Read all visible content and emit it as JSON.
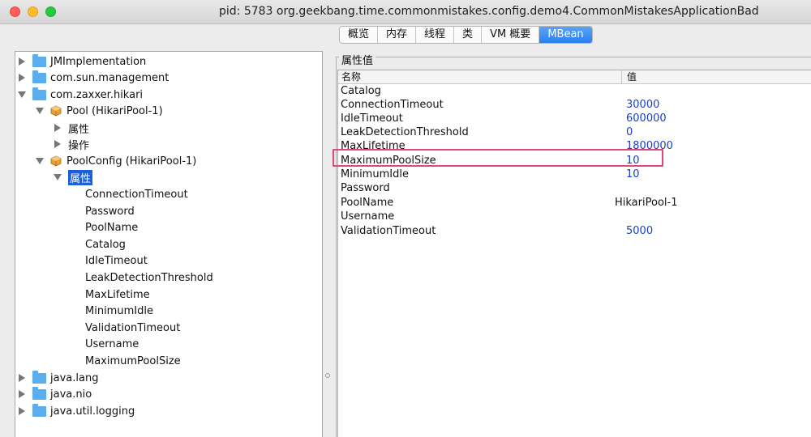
{
  "window": {
    "title": "pid: 5783 org.geekbang.time.commonmistakes.config.demo4.CommonMistakesApplicationBad"
  },
  "tabs": [
    {
      "label": "概览"
    },
    {
      "label": "内存"
    },
    {
      "label": "线程"
    },
    {
      "label": "类"
    },
    {
      "label": "VM 概要"
    },
    {
      "label": "MBean",
      "active": true
    }
  ],
  "tree": {
    "nodes": [
      {
        "label": "JMImplementation"
      },
      {
        "label": "com.sun.management"
      },
      {
        "label": "com.zaxxer.hikari"
      },
      {
        "label": "Pool (HikariPool-1)"
      },
      {
        "label": "属性"
      },
      {
        "label": "操作"
      },
      {
        "label": "PoolConfig (HikariPool-1)"
      },
      {
        "label": "属性",
        "selected": true
      },
      {
        "label": "ConnectionTimeout"
      },
      {
        "label": "Password"
      },
      {
        "label": "PoolName"
      },
      {
        "label": "Catalog"
      },
      {
        "label": "IdleTimeout"
      },
      {
        "label": "LeakDetectionThreshold"
      },
      {
        "label": "MaxLifetime"
      },
      {
        "label": "MinimumIdle"
      },
      {
        "label": "ValidationTimeout"
      },
      {
        "label": "Username"
      },
      {
        "label": "MaximumPoolSize"
      },
      {
        "label": "java.lang"
      },
      {
        "label": "java.nio"
      },
      {
        "label": "java.util.logging"
      }
    ]
  },
  "attributes": {
    "group_title": "属性值",
    "columns": {
      "name": "名称",
      "value": "值"
    },
    "rows": [
      {
        "name": "Catalog",
        "value": ""
      },
      {
        "name": "ConnectionTimeout",
        "value": "30000"
      },
      {
        "name": "IdleTimeout",
        "value": "600000"
      },
      {
        "name": "LeakDetectionThreshold",
        "value": "0"
      },
      {
        "name": "MaxLifetime",
        "value": "1800000"
      },
      {
        "name": "MaximumPoolSize",
        "value": "10",
        "highlighted": true
      },
      {
        "name": "MinimumIdle",
        "value": "10"
      },
      {
        "name": "Password",
        "value": ""
      },
      {
        "name": "PoolName",
        "value": "HikariPool-1"
      },
      {
        "name": "Username",
        "value": ""
      },
      {
        "name": "ValidationTimeout",
        "value": "5000"
      }
    ]
  },
  "colors": {
    "selection": "#1a5ed8",
    "highlight_box": "#e0487a",
    "numeric_value": "#1a3fc4"
  }
}
